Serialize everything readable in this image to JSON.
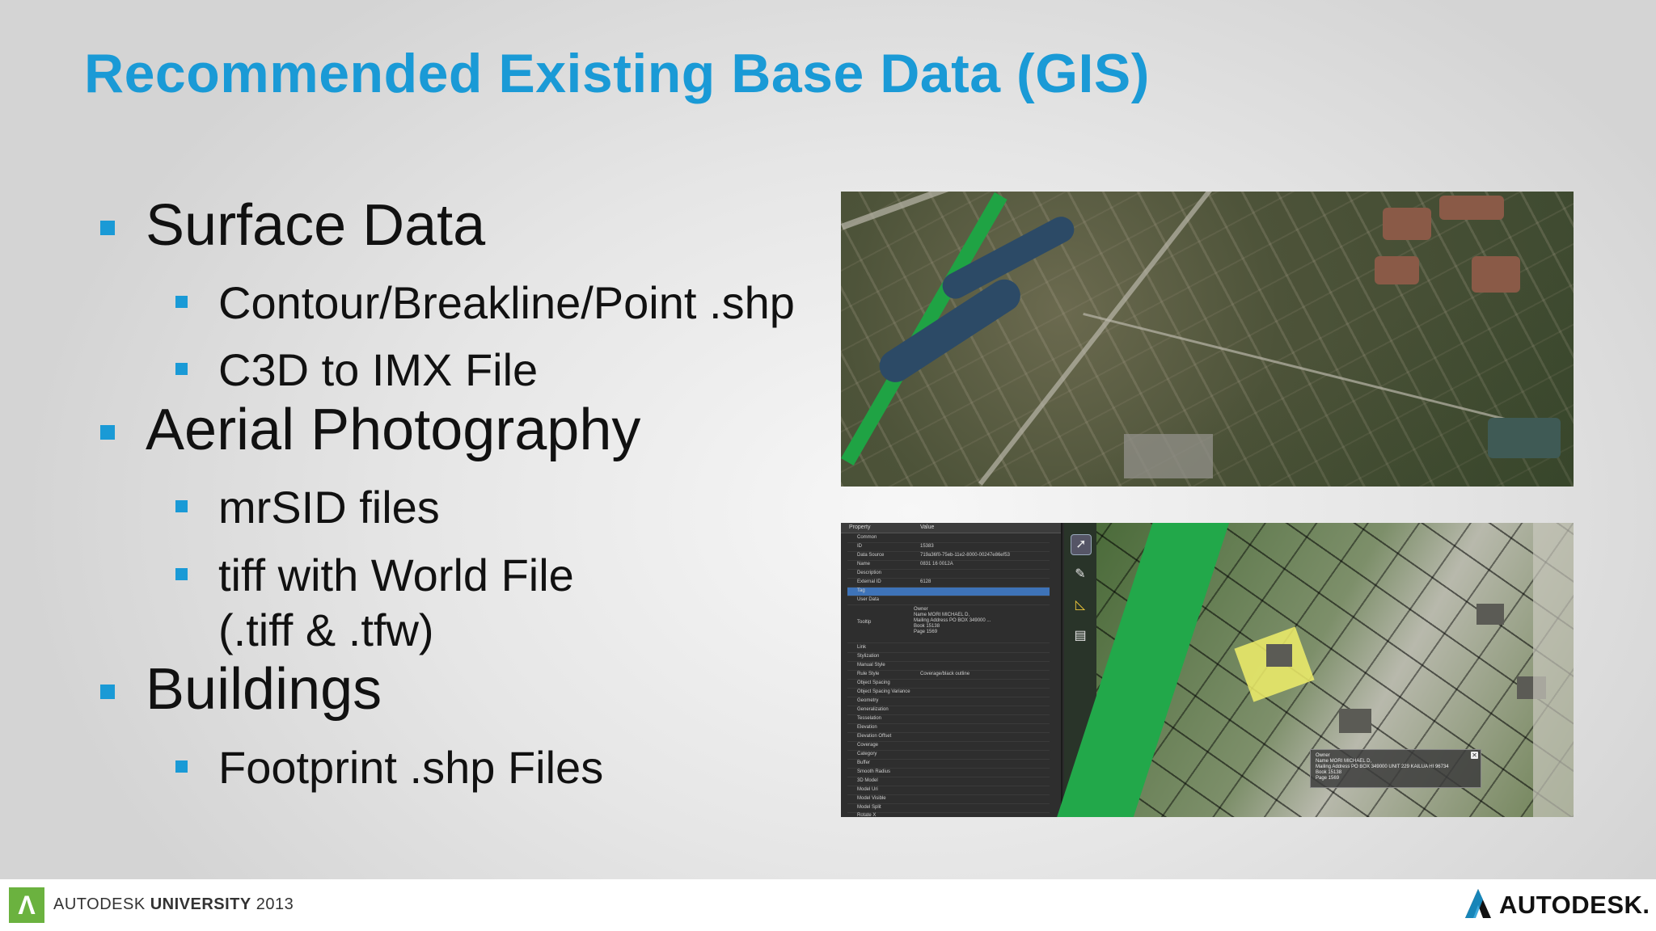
{
  "title": "Recommended Existing Base Data (GIS)",
  "bullets": [
    {
      "text": "Surface Data",
      "children": [
        "Contour/Breakline/Point .shp",
        "C3D to IMX File"
      ]
    },
    {
      "text": "Aerial Photography",
      "children": [
        "mrSID files",
        "tiff with World File",
        "(.tiff & .tfw)"
      ]
    },
    {
      "text": "Buildings",
      "children": [
        "Footprint .shp Files"
      ]
    }
  ],
  "screenshot_panel": {
    "headers": [
      "Property",
      "Value"
    ],
    "rows": [
      {
        "key": "Common",
        "value": ""
      },
      {
        "key": "ID",
        "value": "15383"
      },
      {
        "key": "Data Source",
        "value": "719a36f0-75eb-11e2-8000-00247e86ef53"
      },
      {
        "key": "Name",
        "value": "0831 16 0012A"
      },
      {
        "key": "Description",
        "value": ""
      },
      {
        "key": "External ID",
        "value": "6128"
      },
      {
        "key": "Tag",
        "value": ""
      },
      {
        "key": "User Data",
        "value": ""
      }
    ],
    "tooltip_label": "Tooltip",
    "tooltip_lines": [
      "Owner",
      "Name        MORI MICHAEL D,",
      "Mailing Address  PO BOX 349000 ...",
      "Book        15138",
      "Page        1569"
    ],
    "rows2": [
      {
        "key": "Link",
        "value": ""
      },
      {
        "key": "Stylization",
        "value": ""
      },
      {
        "key": "Manual Style",
        "value": ""
      },
      {
        "key": "Rule Style",
        "value": "Coverage/black outline"
      },
      {
        "key": "Object Spacing",
        "value": ""
      },
      {
        "key": "Object Spacing Variance",
        "value": ""
      },
      {
        "key": "Geometry",
        "value": ""
      },
      {
        "key": "Generalization",
        "value": ""
      },
      {
        "key": "Tesselation",
        "value": ""
      },
      {
        "key": "Elevation",
        "value": ""
      },
      {
        "key": "Elevation Offset",
        "value": ""
      },
      {
        "key": "Coverage",
        "value": ""
      },
      {
        "key": "Category",
        "value": ""
      },
      {
        "key": "Buffer",
        "value": ""
      },
      {
        "key": "Smooth Radius",
        "value": ""
      },
      {
        "key": "3D Model",
        "value": ""
      },
      {
        "key": "Model Uri",
        "value": ""
      },
      {
        "key": "Model Visible",
        "value": ""
      },
      {
        "key": "Model Split",
        "value": ""
      },
      {
        "key": "Rotate X",
        "value": ""
      }
    ],
    "popup_lines": [
      "Owner",
      "Name      MORI MICHAEL D,",
      "Mailing Address   PO BOX 349000 UNIT 229 KAILUA HI 96734",
      "Book      15138",
      "Page      1569"
    ],
    "popup_close": "✕"
  },
  "footer": {
    "au_prefix": "AUTODESK ",
    "au_bold": "UNIVERSITY",
    "au_year": " 2013",
    "brand": "AUTODESK."
  },
  "colors": {
    "accent": "#1a9ad6",
    "au_green": "#6bb23f"
  },
  "icons": {
    "toolbar": [
      "select-icon",
      "edit-icon",
      "measure-icon",
      "layers-icon"
    ],
    "au": "autodesk-university-logo-icon",
    "autodesk": "autodesk-logo-icon"
  }
}
